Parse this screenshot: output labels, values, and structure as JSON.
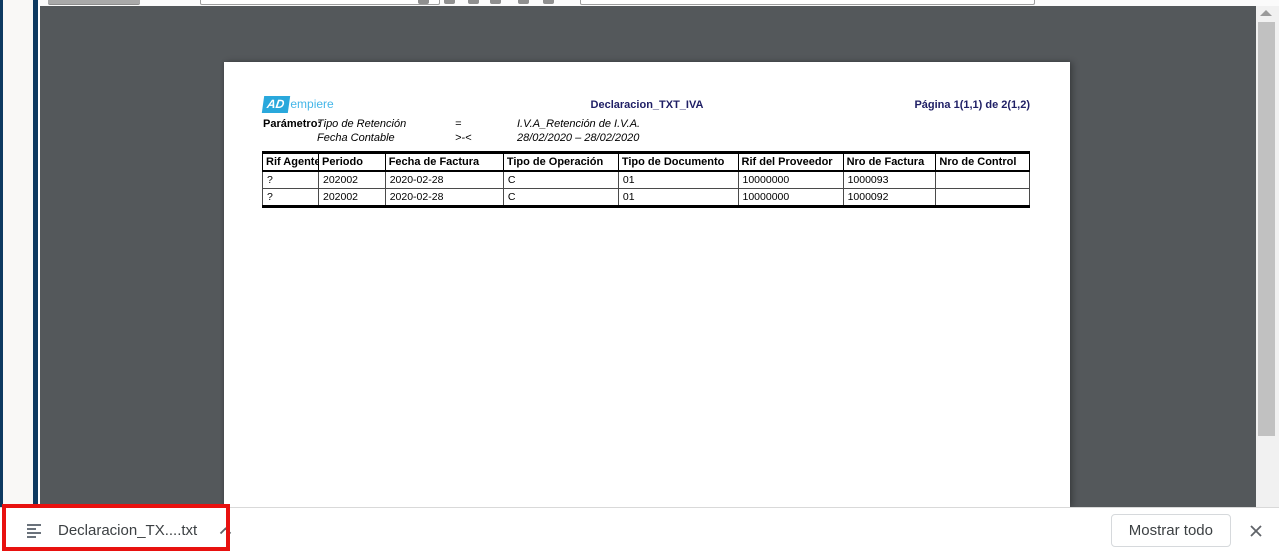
{
  "colors": {
    "rail-navy": "#0e3a61",
    "viewer-bg": "#54585b",
    "brand-blue": "#29a8dc",
    "brand-blue-light": "#45b6e8",
    "title-navy": "#202066",
    "annotation-red": "#e8110f",
    "chip-gray": "#3c4043"
  },
  "document": {
    "logo": {
      "ad": "AD",
      "rest": "empiere"
    },
    "title": "Declaracion_TXT_IVA",
    "page_info": "Página 1(1,1) de 2(1,2)",
    "param_label": "Parámetro:",
    "params": [
      {
        "name": "Tipo de Retención",
        "op": "=",
        "value": "I.V.A_Retención de I.V.A."
      },
      {
        "name": "Fecha Contable",
        "op": ">-<",
        "value": "28/02/2020 – 28/02/2020"
      }
    ],
    "table": {
      "columns": [
        "Rif Agente",
        "Periodo",
        "Fecha de Factura",
        "Tipo de Operación",
        "Tipo de Documento",
        "Rif del Proveedor",
        "Nro de Factura",
        "Nro de Control"
      ],
      "rows": [
        [
          "?",
          "202002",
          "2020-02-28",
          "C",
          "01",
          "10000000",
          "1000093",
          ""
        ],
        [
          "?",
          "202002",
          "2020-02-28",
          "C",
          "01",
          "10000000",
          "1000092",
          ""
        ]
      ]
    }
  },
  "download_bar": {
    "file_label": "Declaracion_TX....txt",
    "show_all_label": "Mostrar todo",
    "file_icon": "text-file-icon",
    "expand_icon": "chevron-up-icon",
    "close_icon": "close-icon"
  }
}
